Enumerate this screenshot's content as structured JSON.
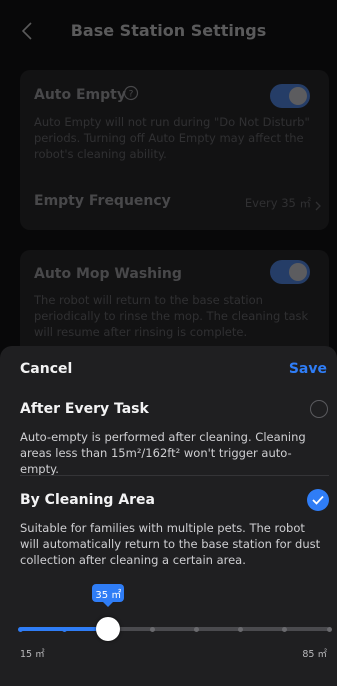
{
  "header": {
    "title": "Base Station Settings"
  },
  "auto_empty": {
    "label": "Auto Empty",
    "description": "Auto Empty will not run during \"Do Not Disturb\" periods. Turning off Auto Empty may affect the robot's cleaning ability.",
    "enabled": true
  },
  "empty_frequency": {
    "label": "Empty Frequency",
    "value": "Every 35 ㎡"
  },
  "auto_mop": {
    "label": "Auto Mop Washing",
    "description": "The robot will return to the base station periodically to rinse the mop. The cleaning task will resume after rinsing is complete.",
    "enabled": true
  },
  "sheet": {
    "cancel_label": "Cancel",
    "save_label": "Save",
    "options": [
      {
        "title": "After Every Task",
        "description": "Auto-empty is performed after cleaning. Cleaning areas less than 15m²/162ft² won't trigger auto-empty.",
        "selected": false
      },
      {
        "title": "By Cleaning Area",
        "description": "Suitable for families with multiple pets. The robot will automatically return to the base station for dust collection after cleaning a certain area.",
        "selected": true
      }
    ],
    "slider": {
      "value_label": "35 ㎡",
      "min_label": "15 ㎡",
      "max_label": "85 ㎡",
      "value": 35,
      "min": 15,
      "max": 85,
      "step": 10
    }
  },
  "colors": {
    "accent": "#2f7df6",
    "sheet_bg": "#1f1f21"
  }
}
